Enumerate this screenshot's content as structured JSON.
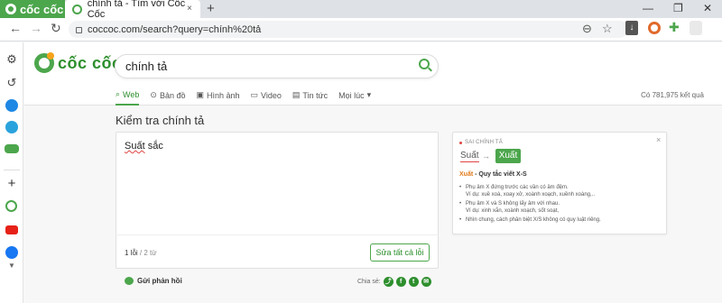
{
  "browser": {
    "brand_label": "cốc cốc",
    "tab_title": "chính tả - Tìm với Cốc Cốc",
    "tab_close": "×",
    "new_tab": "+",
    "url": "coccoc.com/search?query=chính%20tả",
    "window_controls": [
      "—",
      "❐",
      "✕"
    ],
    "icons": [
      "back-icon",
      "forward-icon",
      "reload-icon",
      "lock-icon",
      "zoom-icon",
      "star-icon",
      "download-icon",
      "coccoc-extension-icon",
      "puzzle-icon",
      "profile-icon"
    ]
  },
  "sidebar": {
    "items": [
      "gear-icon",
      "history-icon",
      "messenger-icon",
      "telegram-icon",
      "game-icon",
      "plus-icon",
      "coccoc-icon",
      "youtube-icon",
      "facebook-icon",
      "chevron-down-icon"
    ]
  },
  "search": {
    "logo_text": "cốc cốc",
    "query": "chính tả",
    "tabs": [
      {
        "label": "Web",
        "icon": "search-icon",
        "active": true
      },
      {
        "label": "Bản đồ",
        "icon": "map-pin-icon",
        "active": false
      },
      {
        "label": "Hình ảnh",
        "icon": "image-icon",
        "active": false
      },
      {
        "label": "Video",
        "icon": "video-icon",
        "active": false
      },
      {
        "label": "Tin tức",
        "icon": "news-icon",
        "active": false
      },
      {
        "label": "Mọi lúc",
        "icon": "chevron-down-icon",
        "active": false
      }
    ],
    "result_count": "Có 781,975 kết quả"
  },
  "spellcheck": {
    "title": "Kiểm tra chính tả",
    "text_error": "Suất",
    "text_rest": " sắc",
    "error_count": "1 lỗi",
    "word_count": " / 2 từ",
    "fix_all_label": "Sửa tất cả lỗi",
    "feedback_label": "Gửi phản hồi",
    "share_label": "Chia sẻ:"
  },
  "suggestion": {
    "label": "SAI CHÍNH TẢ",
    "wrong": "Suất",
    "arrow": "→",
    "correct": "Xuất",
    "rule_keyword": "Xuất",
    "rule_title": " - Quy tắc viết X-S",
    "rules": [
      "Phụ âm X đứng trước các vần có âm đệm.\nVí dụ: xuề xoà, xoay xở, xoành xoạch, xuềnh xoàng,..",
      "Phụ âm X và S không lấy âm với nhau.\nVí dụ: xinh xắn, xoành xoạch, sốt soạt,",
      "Nhìn chung, cách phân biệt X/S không có quy luật riêng."
    ],
    "close": "×"
  },
  "colors": {
    "brand_green": "#4ca64c",
    "error_red": "#e04343",
    "keyword_orange": "#e07a1a"
  }
}
